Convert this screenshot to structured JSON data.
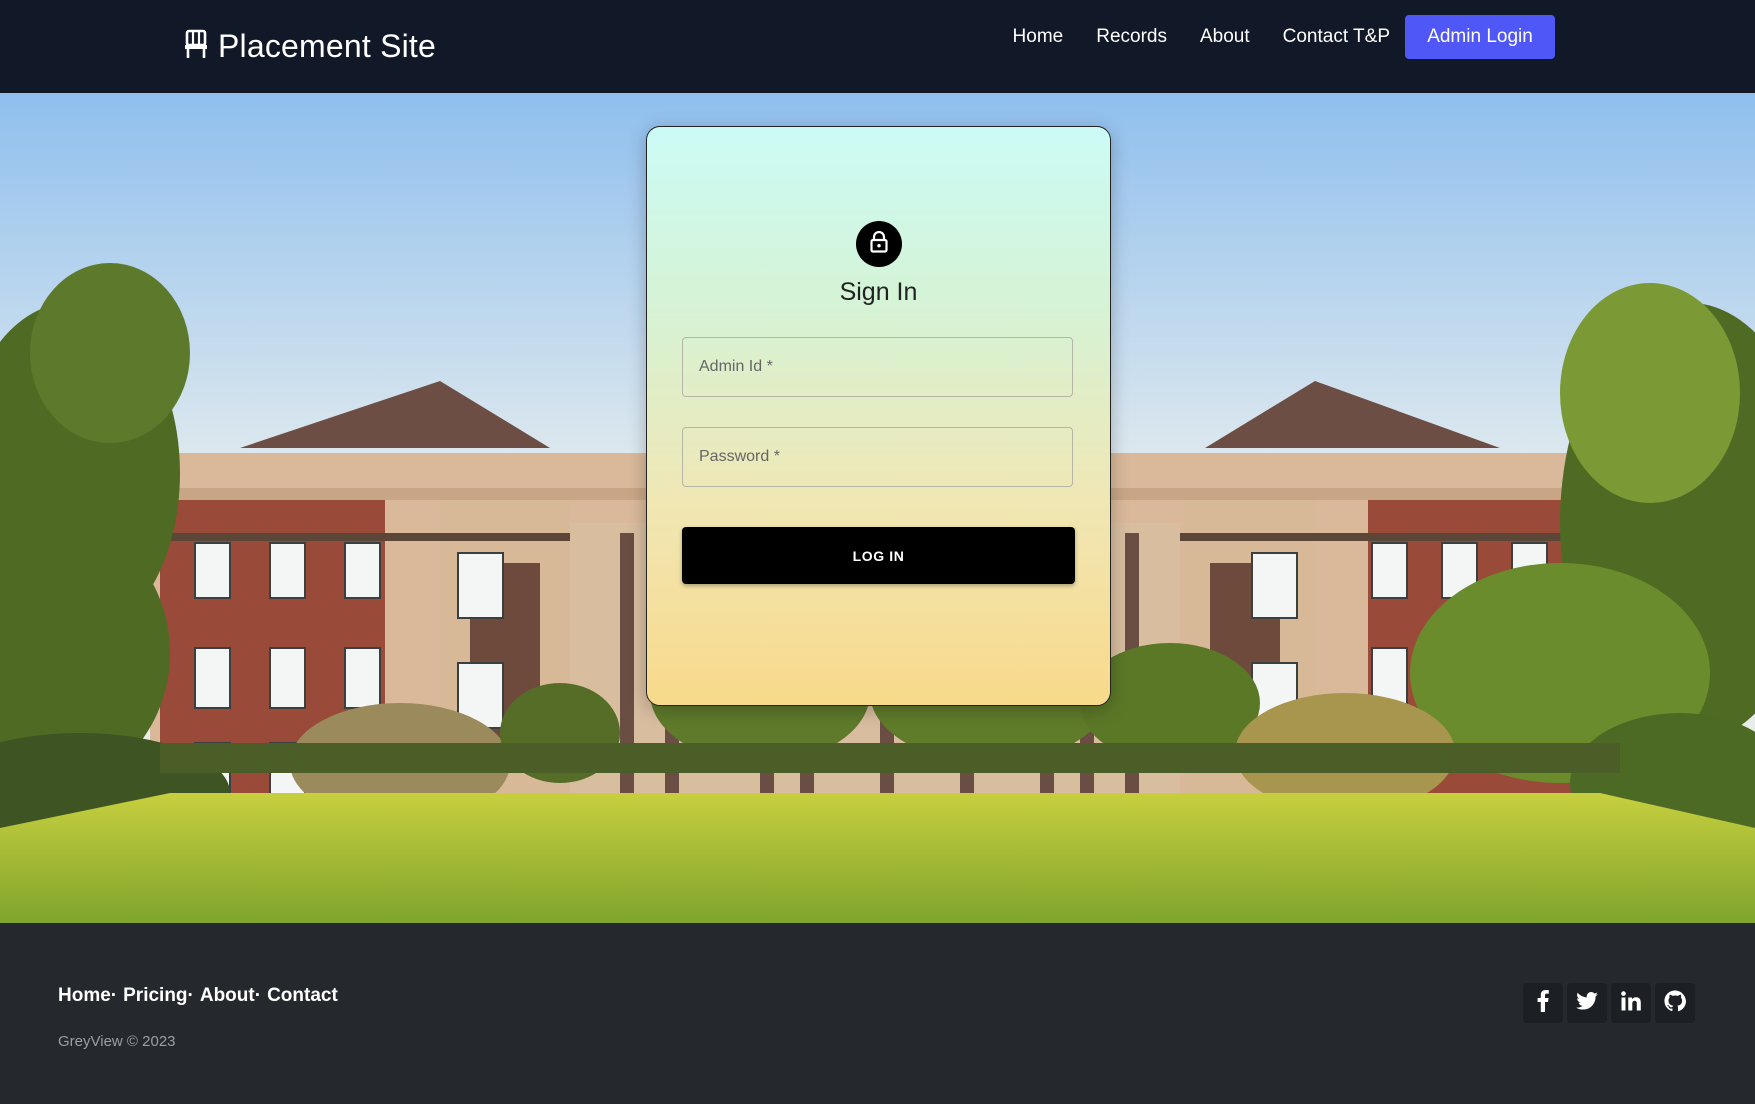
{
  "navbar": {
    "brand_icon": "chair-icon",
    "brand": "Placement Site",
    "links": [
      {
        "label": "Home"
      },
      {
        "label": "Records"
      },
      {
        "label": "About"
      },
      {
        "label": "Contact T&P"
      }
    ],
    "admin_button": "Admin Login",
    "accent_color": "#4f57f6"
  },
  "signin": {
    "icon": "lock-icon",
    "title": "Sign In",
    "admin_id_placeholder": "Admin Id *",
    "password_placeholder": "Password *",
    "login_button": "LOG IN"
  },
  "footer": {
    "links": [
      {
        "label": "Home"
      },
      {
        "label": "Pricing"
      },
      {
        "label": "About"
      },
      {
        "label": "Contact"
      }
    ],
    "copyright": "GreyView © 2023",
    "socials": [
      "facebook-icon",
      "twitter-icon",
      "linkedin-icon",
      "github-icon"
    ]
  }
}
